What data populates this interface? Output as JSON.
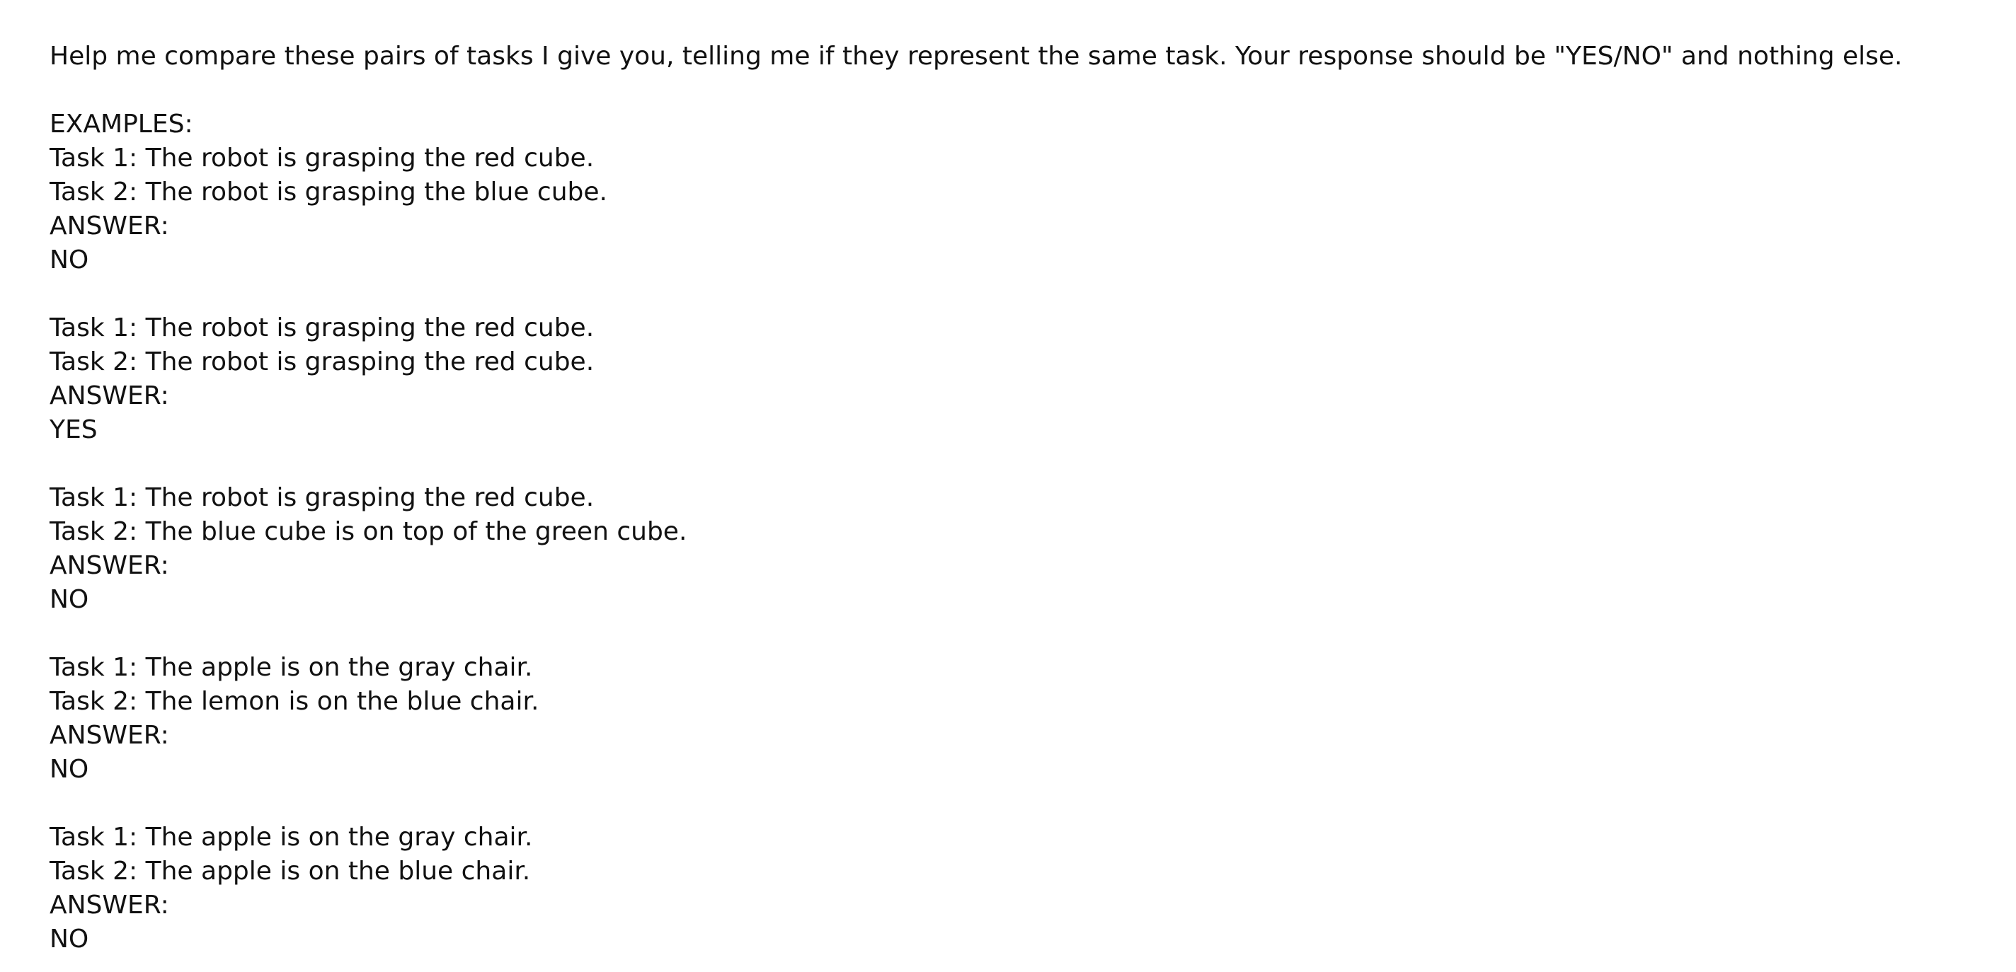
{
  "document": {
    "intro": "Help me compare these pairs of tasks I give you, telling me if they represent the same task. Your response should be \"YES/NO\" and nothing else.",
    "examples_heading": "EXAMPLES:",
    "examples": [
      {
        "task1": "Task 1: The robot is grasping the red cube.",
        "task2": "Task 2: The robot is grasping the blue cube.",
        "answer_label": "ANSWER:",
        "answer": "NO"
      },
      {
        "task1": "Task 1: The robot is grasping the red cube.",
        "task2": "Task 2: The robot is grasping the red cube.",
        "answer_label": "ANSWER:",
        "answer": "YES"
      },
      {
        "task1": "Task 1: The robot is grasping the red cube.",
        "task2": "Task 2: The blue cube is on top of the green cube.",
        "answer_label": "ANSWER:",
        "answer": "NO"
      },
      {
        "task1": "Task 1: The apple is on the gray chair.",
        "task2": "Task 2: The lemon is on the blue chair.",
        "answer_label": "ANSWER:",
        "answer": "NO"
      },
      {
        "task1": "Task 1: The apple is on the gray chair.",
        "task2": "Task 2: The apple is on the blue chair.",
        "answer_label": "ANSWER:",
        "answer": "NO"
      }
    ]
  }
}
